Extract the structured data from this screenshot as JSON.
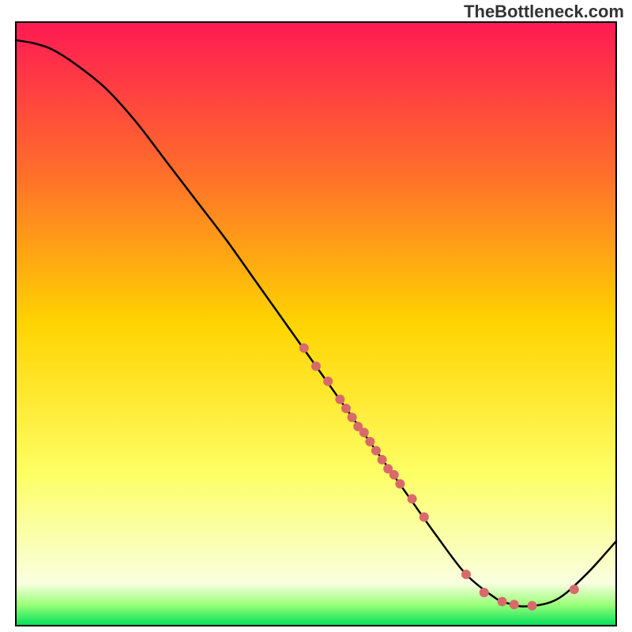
{
  "watermark": "TheBottleneck.com",
  "chart_data": {
    "type": "line",
    "title": "",
    "xlabel": "",
    "ylabel": "",
    "xlim": [
      0,
      100
    ],
    "ylim": [
      0,
      100
    ],
    "grid": false,
    "legend": false,
    "background_gradient": {
      "stops": [
        {
          "offset": 0.0,
          "color": "#ff1a53"
        },
        {
          "offset": 0.25,
          "color": "#ff6e2b"
        },
        {
          "offset": 0.5,
          "color": "#ffd400"
        },
        {
          "offset": 0.75,
          "color": "#fdff66"
        },
        {
          "offset": 0.93,
          "color": "#f9ffe0"
        },
        {
          "offset": 0.965,
          "color": "#9bff7a"
        },
        {
          "offset": 1.0,
          "color": "#00e05a"
        }
      ]
    },
    "series": [
      {
        "name": "curve",
        "color": "#000000",
        "x": [
          0,
          3,
          6,
          10,
          15,
          20,
          25,
          30,
          35,
          40,
          45,
          50,
          55,
          60,
          65,
          70,
          75,
          80,
          82,
          85,
          90,
          95,
          100
        ],
        "y": [
          97,
          96.5,
          95.5,
          93,
          89,
          83.5,
          77,
          70.5,
          64,
          57,
          50,
          43,
          36,
          29,
          22,
          15,
          8.5,
          4.5,
          3.7,
          3.2,
          4.3,
          8.5,
          14
        ]
      }
    ],
    "points": {
      "name": "scatter-on-curve",
      "color": "#d86a6a",
      "radius": 6,
      "data": [
        {
          "x": 48,
          "y": 46
        },
        {
          "x": 50,
          "y": 43
        },
        {
          "x": 52,
          "y": 40.5
        },
        {
          "x": 54,
          "y": 37.5
        },
        {
          "x": 55,
          "y": 36
        },
        {
          "x": 56,
          "y": 34.5
        },
        {
          "x": 57,
          "y": 33
        },
        {
          "x": 58,
          "y": 32
        },
        {
          "x": 59,
          "y": 30.5
        },
        {
          "x": 60,
          "y": 29
        },
        {
          "x": 61,
          "y": 27.5
        },
        {
          "x": 62,
          "y": 26
        },
        {
          "x": 63,
          "y": 25
        },
        {
          "x": 64,
          "y": 23.5
        },
        {
          "x": 66,
          "y": 21
        },
        {
          "x": 68,
          "y": 18
        },
        {
          "x": 75,
          "y": 8.5
        },
        {
          "x": 78,
          "y": 5.5
        },
        {
          "x": 81,
          "y": 4
        },
        {
          "x": 83,
          "y": 3.5
        },
        {
          "x": 86,
          "y": 3.3
        },
        {
          "x": 93,
          "y": 6
        }
      ]
    },
    "axes_visible": false,
    "frame_color": "#000000",
    "frame_width": 2
  }
}
